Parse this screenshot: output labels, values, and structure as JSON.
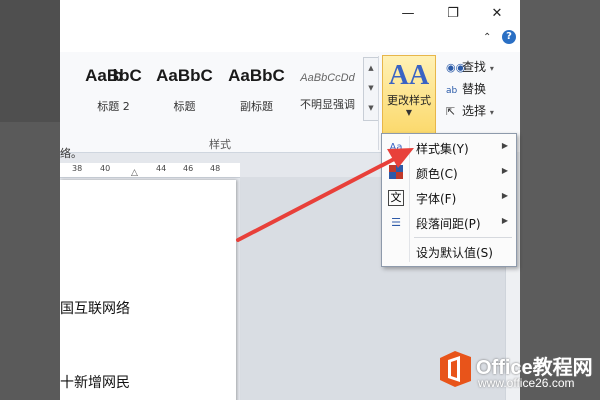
{
  "window": {
    "minimize": "—",
    "restore": "❐",
    "close": "✕"
  },
  "ribbon": {
    "styles": [
      {
        "preview": "b",
        "label": ""
      },
      {
        "preview": "AaBbC",
        "label": "标题 2"
      },
      {
        "preview": "AaBbC",
        "label": "标题"
      },
      {
        "preview": "AaBbC",
        "label": "副标题"
      },
      {
        "preview": "AaBbCcDd",
        "label": "不明显强调"
      }
    ],
    "group_label": "样式",
    "change_styles": {
      "icon_text": "AA",
      "label": "更改样式"
    },
    "editing": [
      {
        "icon": "find-icon",
        "label": "查找"
      },
      {
        "icon": "replace-icon",
        "label": "替换"
      },
      {
        "icon": "select-icon",
        "label": "选择"
      }
    ]
  },
  "side_text": "络。",
  "ruler": {
    "ticks": [
      "38",
      "40",
      "44",
      "46",
      "48"
    ]
  },
  "document": {
    "lines": [
      "国互联网络",
      "十新增网民"
    ]
  },
  "dropdown_menu": {
    "items": [
      {
        "icon": "style-set-icon",
        "label": "样式集(Y)",
        "submenu": true
      },
      {
        "icon": "colors-icon",
        "label": "颜色(C)",
        "submenu": true
      },
      {
        "icon": "fonts-icon",
        "label": "字体(F)",
        "submenu": true
      },
      {
        "icon": "paragraph-spacing-icon",
        "label": "段落间距(P)",
        "submenu": true
      },
      {
        "icon": "",
        "label": "设为默认值(S)",
        "submenu": false
      }
    ]
  },
  "watermark": {
    "brand": "Office教程网",
    "url": "www.office26.com"
  },
  "colors": {
    "accent": "#fbd96c",
    "arrow": "#e8403a",
    "watermark_orange": "#e8541a"
  }
}
